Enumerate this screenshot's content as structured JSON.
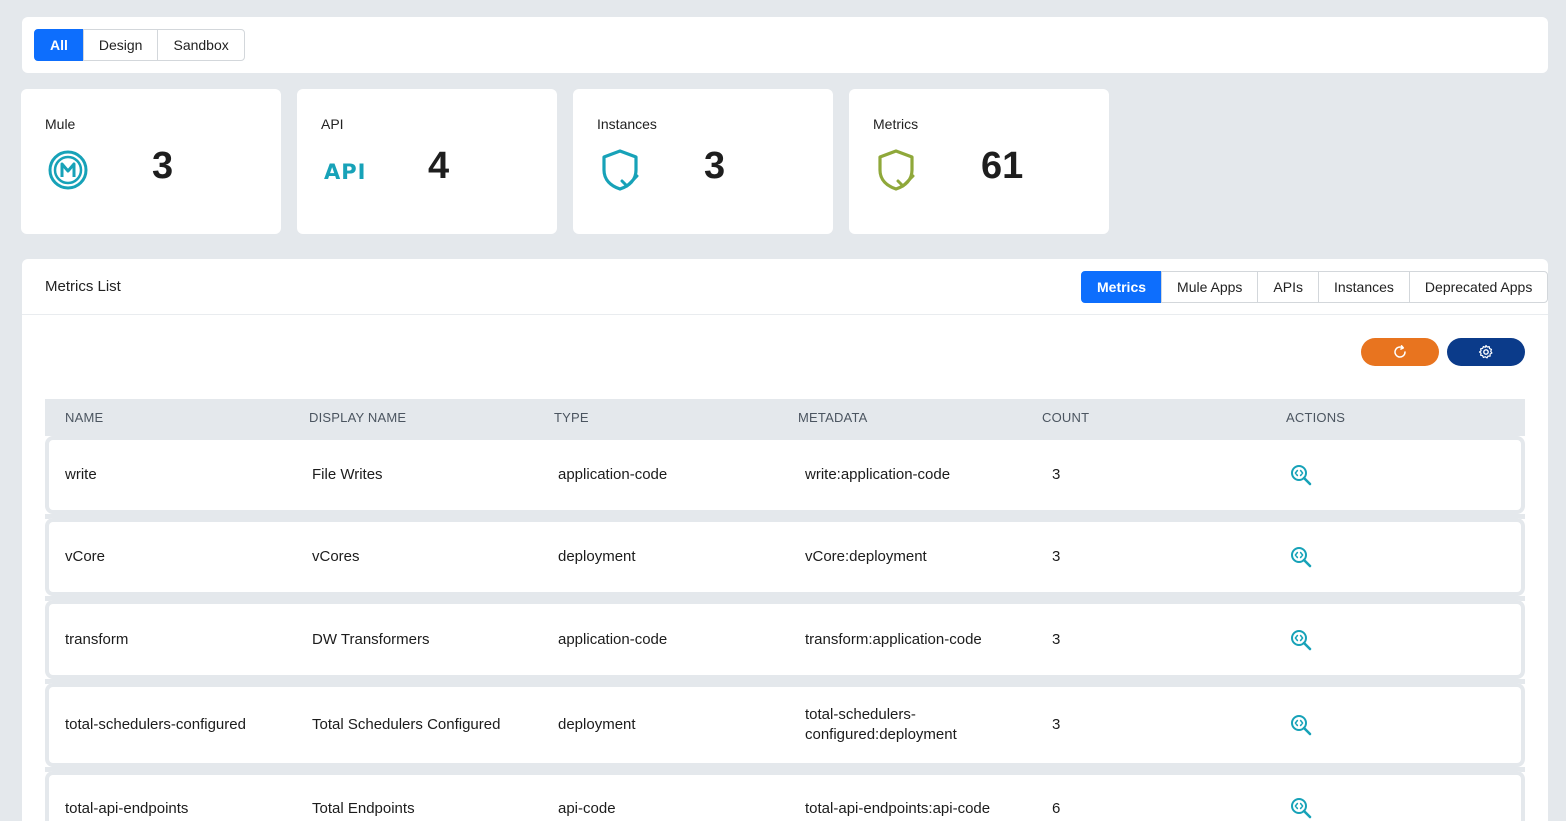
{
  "environments": {
    "tabs": [
      "All",
      "Design",
      "Sandbox"
    ],
    "active": "All"
  },
  "stats": [
    {
      "label": "Mule",
      "value": "3",
      "icon": "mule-icon",
      "color": "#17a2b8"
    },
    {
      "label": "API",
      "value": "4",
      "icon": "api-icon",
      "color": "#17a2b8"
    },
    {
      "label": "Instances",
      "value": "3",
      "icon": "shield-check-icon",
      "color": "#17a2b8"
    },
    {
      "label": "Metrics",
      "value": "61",
      "icon": "shield-check-icon",
      "color": "#8fa83a"
    }
  ],
  "metrics_panel": {
    "title": "Metrics List",
    "tabs": [
      "Metrics",
      "Mule Apps",
      "APIs",
      "Instances",
      "Deprecated Apps"
    ],
    "active_tab": "Metrics",
    "columns": [
      "NAME",
      "DISPLAY NAME",
      "TYPE",
      "METADATA",
      "COUNT",
      "ACTIONS"
    ],
    "rows": [
      {
        "name": "write",
        "display_name": "File Writes",
        "type": "application-code",
        "metadata": "write:application-code",
        "count": "3"
      },
      {
        "name": "vCore",
        "display_name": "vCores",
        "type": "deployment",
        "metadata": "vCore:deployment",
        "count": "3"
      },
      {
        "name": "transform",
        "display_name": "DW Transformers",
        "type": "application-code",
        "metadata": "transform:application-code",
        "count": "3"
      },
      {
        "name": "total-schedulers-configured",
        "display_name": "Total Schedulers Configured",
        "type": "deployment",
        "metadata": "total-schedulers-configured:deployment",
        "count": "3"
      },
      {
        "name": "total-api-endpoints",
        "display_name": "Total Endpoints",
        "type": "api-code",
        "metadata": "total-api-endpoints:api-code",
        "count": "6"
      }
    ]
  },
  "colors": {
    "primary": "#0d6efd",
    "refresh": "#e8741f",
    "settings": "#0b3b8a",
    "teal": "#17a2b8",
    "olive": "#8fa83a"
  }
}
